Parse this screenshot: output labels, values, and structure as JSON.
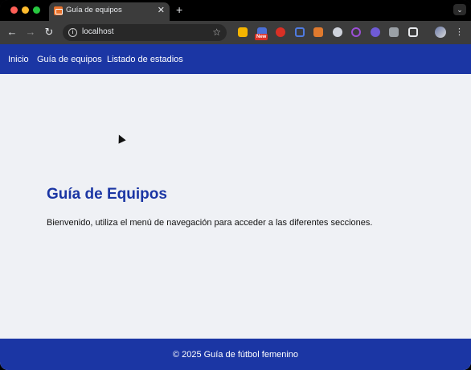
{
  "browser": {
    "tab": {
      "title": "Guía de equipos",
      "close_glyph": "✕"
    },
    "new_tab_glyph": "+",
    "tab_menu_glyph": "⌄",
    "toolbar": {
      "back_glyph": "←",
      "forward_glyph": "→",
      "reload_glyph": "↻",
      "url": "localhost",
      "info_glyph": "i",
      "star_glyph": "☆",
      "menu_glyph": "⋮",
      "extension_badge": "New"
    }
  },
  "site": {
    "nav": [
      "Inicio",
      "Guía de equipos",
      "Listado de estadios"
    ],
    "heading": "Guía de Equipos",
    "welcome": "Bienvenido, utiliza el menú de navegación para acceder a las diferentes secciones.",
    "footer": "© 2025 Guía de fútbol femenino"
  },
  "colors": {
    "brand": "#1b36a4",
    "page_bg": "#eff1f5"
  }
}
